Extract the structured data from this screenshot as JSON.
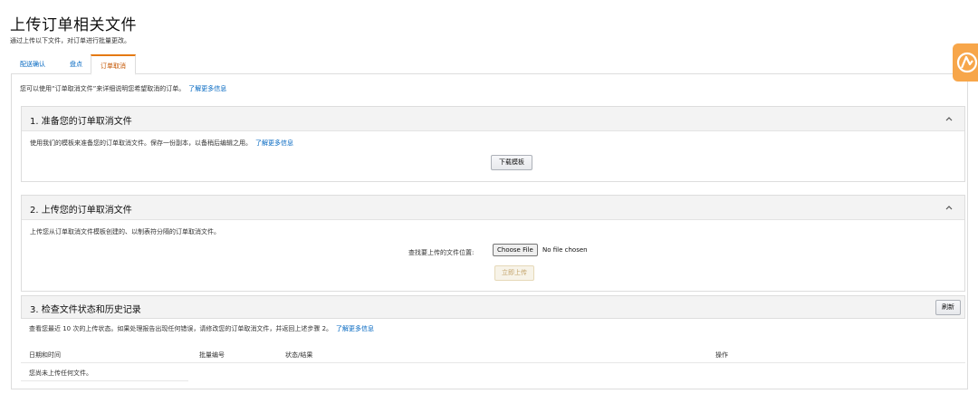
{
  "page": {
    "title": "上传订单相关文件",
    "subtitle": "通过上传以下文件，对订单进行批量更改。"
  },
  "tabs": [
    {
      "label": "配送确认"
    },
    {
      "label": "盘点"
    },
    {
      "label": "订单取消",
      "active": true
    }
  ],
  "intro": {
    "text": "您可以使用“订单取消文件”来详细说明您希望取消的订单。",
    "link": "了解更多信息"
  },
  "section1": {
    "title": "1. 准备您的订单取消文件",
    "desc": "使用我们的模板来准备您的订单取消文件。保存一份副本，以备稍后编辑之用。",
    "link": "了解更多信息",
    "button": "下载模板"
  },
  "section2": {
    "title": "2. 上传您的订单取消文件",
    "desc": "上传您从订单取消文件模板创建的、以制表符分隔的订单取消文件。",
    "file_label": "查找要上传的文件位置:",
    "choose_file": "Choose File",
    "no_file": "No file chosen",
    "upload_button": "立即上传"
  },
  "section3": {
    "title": "3. 检查文件状态和历史记录",
    "refresh": "刷新",
    "desc": "查看您最近 10 次的上传状态。如果处理报告出现任何错误，请修改您的订单取消文件，并返回上述步骤 2。",
    "link": "了解更多信息",
    "columns": [
      "日期和时间",
      "批量编号",
      "状态/结果",
      "操作"
    ],
    "empty": "您尚未上传任何文件。"
  },
  "colors": {
    "link": "#0066c0",
    "active_tab": "#c45500",
    "accent": "#e47911",
    "corner_logo": "#f7a64a"
  }
}
